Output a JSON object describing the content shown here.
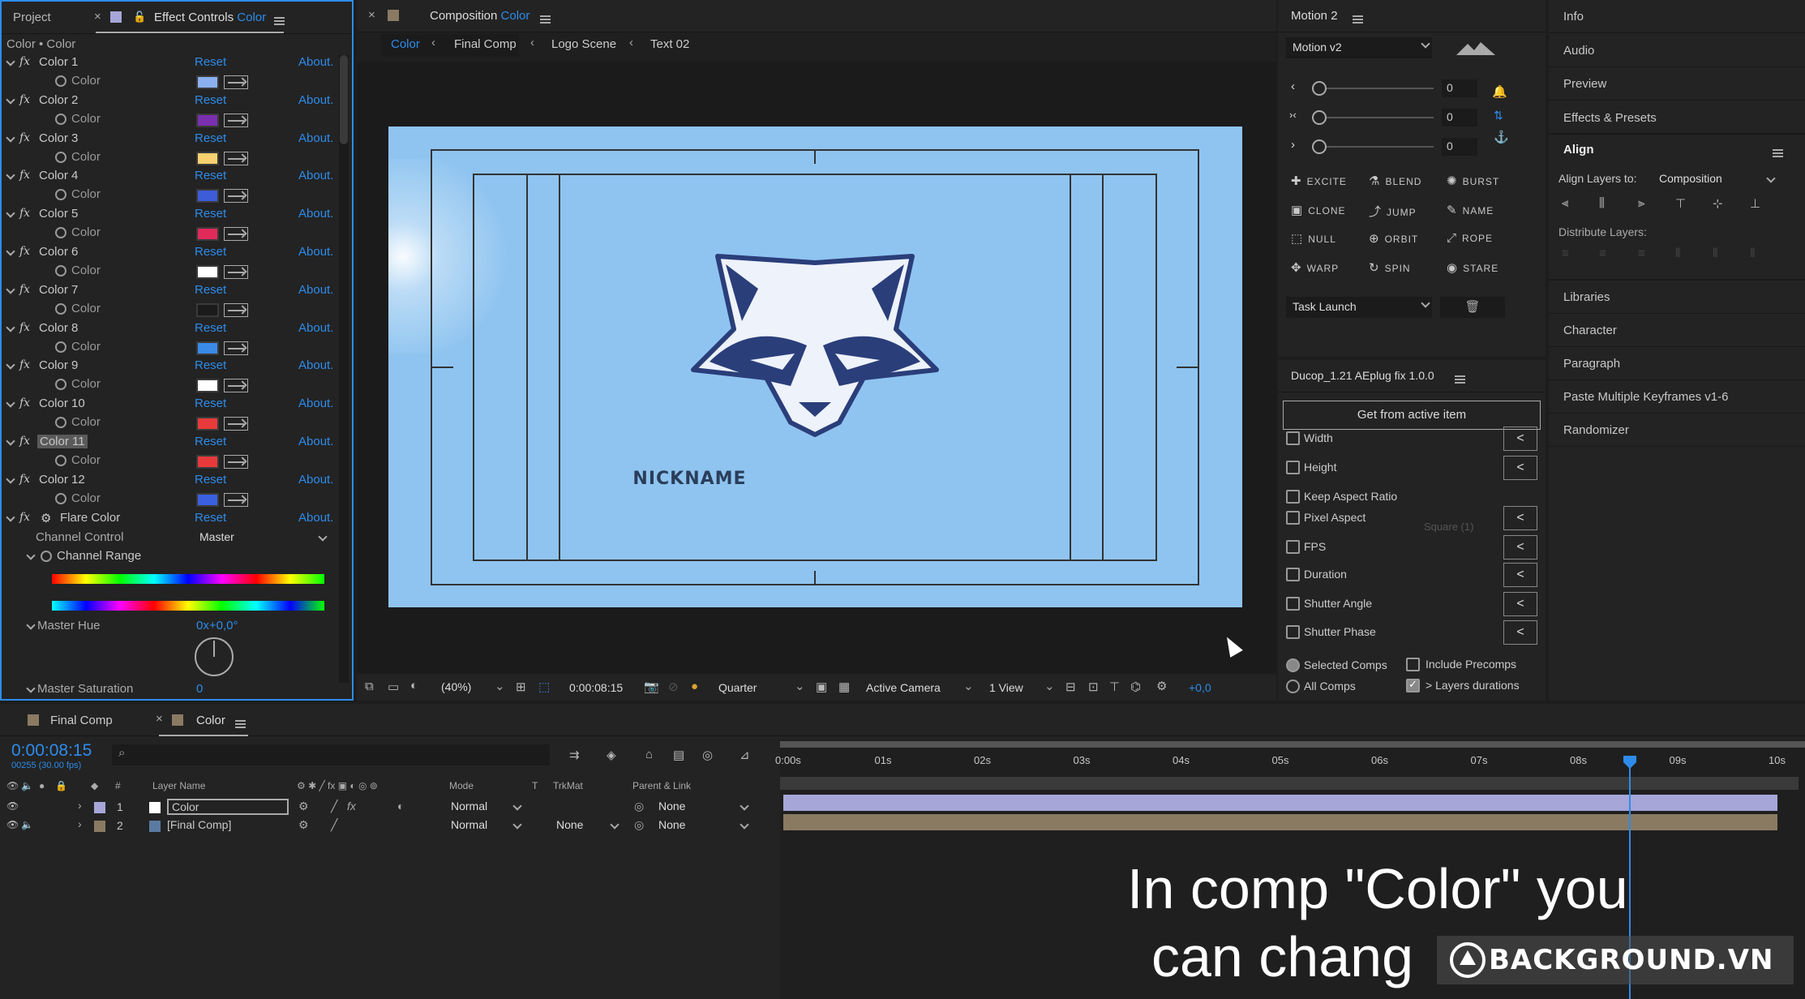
{
  "effect_controls": {
    "tab_project": "Project",
    "tab_prefix": "Effect Controls",
    "tab_comp": "Color",
    "breadcrumb": "Color • Color",
    "reset": "Reset",
    "about": "About.",
    "color_label": "Color",
    "effects": [
      {
        "name": "Color 1",
        "swatch": "#8ab0f0"
      },
      {
        "name": "Color 2",
        "swatch": "#7a2fb0"
      },
      {
        "name": "Color 3",
        "swatch": "#f8d070"
      },
      {
        "name": "Color 4",
        "swatch": "#3c5cd8"
      },
      {
        "name": "Color 5",
        "swatch": "#e02a5a"
      },
      {
        "name": "Color 6",
        "swatch": "#ffffff"
      },
      {
        "name": "Color 7",
        "swatch": "#1b1b1b"
      },
      {
        "name": "Color 8",
        "swatch": "#3a8ae8"
      },
      {
        "name": "Color 9",
        "swatch": "#ffffff"
      },
      {
        "name": "Color 10",
        "swatch": "#e83a3a"
      },
      {
        "name": "Color 11",
        "swatch": "#e83a3a"
      },
      {
        "name": "Color 12",
        "swatch": "#3a60e0"
      }
    ],
    "flare": {
      "name": "Flare Color",
      "channel_control_label": "Channel Control",
      "channel_control_value": "Master",
      "channel_range": "Channel Range",
      "master_hue": "Master Hue",
      "master_hue_value": "0x+0,0°",
      "master_saturation": "Master Saturation",
      "master_saturation_value": "0"
    }
  },
  "composition": {
    "tab_prefix": "Composition",
    "tab_comp": "Color",
    "breadcrumbs": [
      "Color",
      "Final Comp",
      "Logo Scene",
      "Text 02"
    ],
    "nickname": "NICKNAME",
    "zoom": "(40%)",
    "timecode": "0:00:08:15",
    "resolution": "Quarter",
    "camera": "Active Camera",
    "view": "1 View",
    "exposure": "+0,0"
  },
  "motion": {
    "title": "Motion 2",
    "preset": "Motion v2",
    "values": [
      "0",
      "0",
      "0"
    ],
    "buttons": [
      [
        "EXCITE",
        "BLEND",
        "BURST"
      ],
      [
        "CLONE",
        "JUMP",
        "NAME"
      ],
      [
        "NULL",
        "ORBIT",
        "ROPE"
      ],
      [
        "WARP",
        "SPIN",
        "STARE"
      ]
    ],
    "task": "Task Launch"
  },
  "ducop": {
    "title": "Ducop_1.21 AEplug fix 1.0.0",
    "get_button": "Get from active item",
    "options": [
      "Width",
      "Height",
      "Keep Aspect Ratio",
      "Pixel Aspect",
      "FPS",
      "Duration",
      "Shutter Angle",
      "Shutter Phase"
    ],
    "pixel_aspect_value": "Square (1)",
    "selected_comps": "Selected Comps",
    "all_comps": "All Comps",
    "include_precomps": "Include Precomps",
    "layers_durations": "> Layers durations",
    "arrow": "<"
  },
  "right_panel": {
    "items_top": [
      "Info",
      "Audio",
      "Preview",
      "Effects & Presets"
    ],
    "align": {
      "title": "Align",
      "align_layers_to": "Align Layers to:",
      "target": "Composition",
      "distribute": "Distribute Layers:"
    },
    "items_bottom": [
      "Libraries",
      "Character",
      "Paragraph",
      "Paste Multiple Keyframes v1-6",
      "Randomizer"
    ]
  },
  "timeline": {
    "tabs": [
      "Final Comp",
      "Color"
    ],
    "timecode": "0:00:08:15",
    "frames": "00255 (30.00 fps)",
    "headers": {
      "layer_name": "Layer Name",
      "mode": "Mode",
      "t": "T",
      "trkmat": "TrkMat",
      "parent": "Parent & Link",
      "num": "#"
    },
    "layers": [
      {
        "num": "1",
        "name": "Color",
        "mode": "Normal",
        "trkmat": "",
        "parent": "None",
        "color": "#a6a6d8"
      },
      {
        "num": "2",
        "name": "[Final Comp]",
        "mode": "Normal",
        "trkmat": "None",
        "parent": "None",
        "color": "#8a7a62"
      }
    ],
    "ruler": [
      "0:00s",
      "01s",
      "02s",
      "03s",
      "04s",
      "05s",
      "06s",
      "07s",
      "08s",
      "09s",
      "10s"
    ]
  },
  "caption": {
    "line1": "In comp \"Color\" you",
    "line2": "can chang"
  },
  "watermark": "BACKGROUND.VN"
}
